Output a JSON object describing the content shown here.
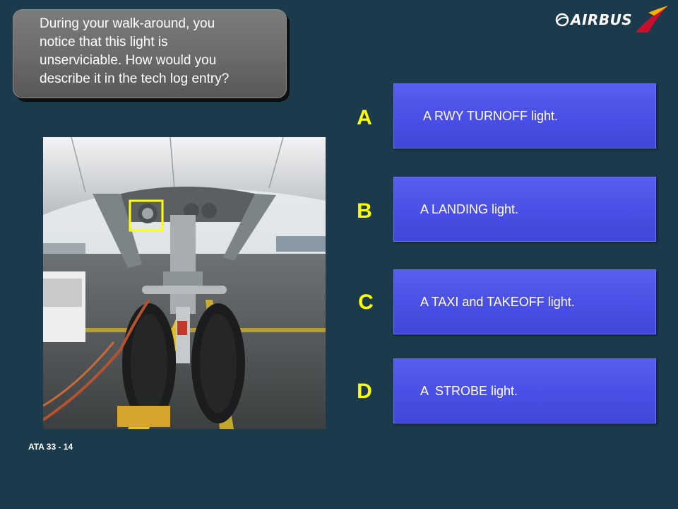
{
  "question": {
    "lines": [
      "During your walk-around, you",
      "notice that this light is",
      "unserviciable. How would you",
      "describe it in the  tech log entry?"
    ]
  },
  "logo": {
    "text": "AIRBUS"
  },
  "reference": {
    "label": "ATA 33 - 14"
  },
  "options": [
    {
      "letter": "A",
      "text": "A RWY TURNOFF light."
    },
    {
      "letter": "B",
      "text": "A LANDING light."
    },
    {
      "letter": "C",
      "text": "A TAXI and TAKEOFF light."
    },
    {
      "letter": "D",
      "text": "A  STROBE light."
    }
  ],
  "colors": {
    "background": "#1b3a4b",
    "option_fill": "#4b50e6",
    "letter": "#ffff00",
    "highlight_box": "#ffff00"
  }
}
